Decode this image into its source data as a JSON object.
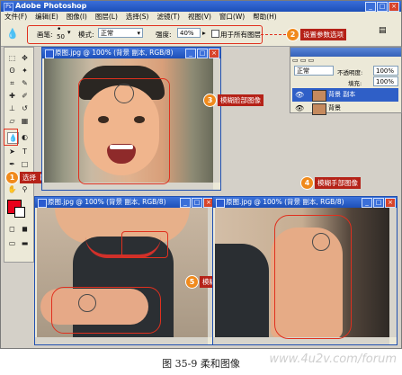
{
  "app": {
    "title": "Adobe Photoshop"
  },
  "menu": [
    "文件(F)",
    "编辑(E)",
    "图像(I)",
    "图层(L)",
    "选择(S)",
    "滤镜(T)",
    "视图(V)",
    "窗口(W)",
    "帮助(H)"
  ],
  "options": {
    "brush_label": "画笔:",
    "brush_size": "50",
    "mode_label": "模式:",
    "mode_value": "正常",
    "strength_label": "强度:",
    "strength_value": "40%",
    "all_layers_label": "用于所有图层"
  },
  "callouts": {
    "c1": {
      "num": "1",
      "text": "选择【模糊工具】"
    },
    "c2": {
      "num": "2",
      "text": "设置参数选项"
    },
    "c3": {
      "num": "3",
      "text": "模糊脸部图像"
    },
    "c4": {
      "num": "4",
      "text": "模糊手部图像"
    },
    "c5": {
      "num": "5",
      "text": "模糊手部和胸部图像"
    }
  },
  "layers_panel": {
    "blend_mode": "正常",
    "opacity_label": "不透明度:",
    "opacity_value": "100%",
    "fill_label": "填充:",
    "fill_value": "100%",
    "layers": [
      {
        "name": "背景 副本"
      },
      {
        "name": "背景"
      }
    ]
  },
  "documents": [
    {
      "title": "原图.jpg @ 100% (背景 副本, RGB/8)"
    },
    {
      "title": "原图.jpg @ 100% (背景 副本, RGB/8)"
    },
    {
      "title": "原图.jpg @ 100% (背景 副本, RGB/8)"
    }
  ],
  "caption": "图 35-9   柔和图像",
  "watermark": "www.4u2v.com/forum"
}
